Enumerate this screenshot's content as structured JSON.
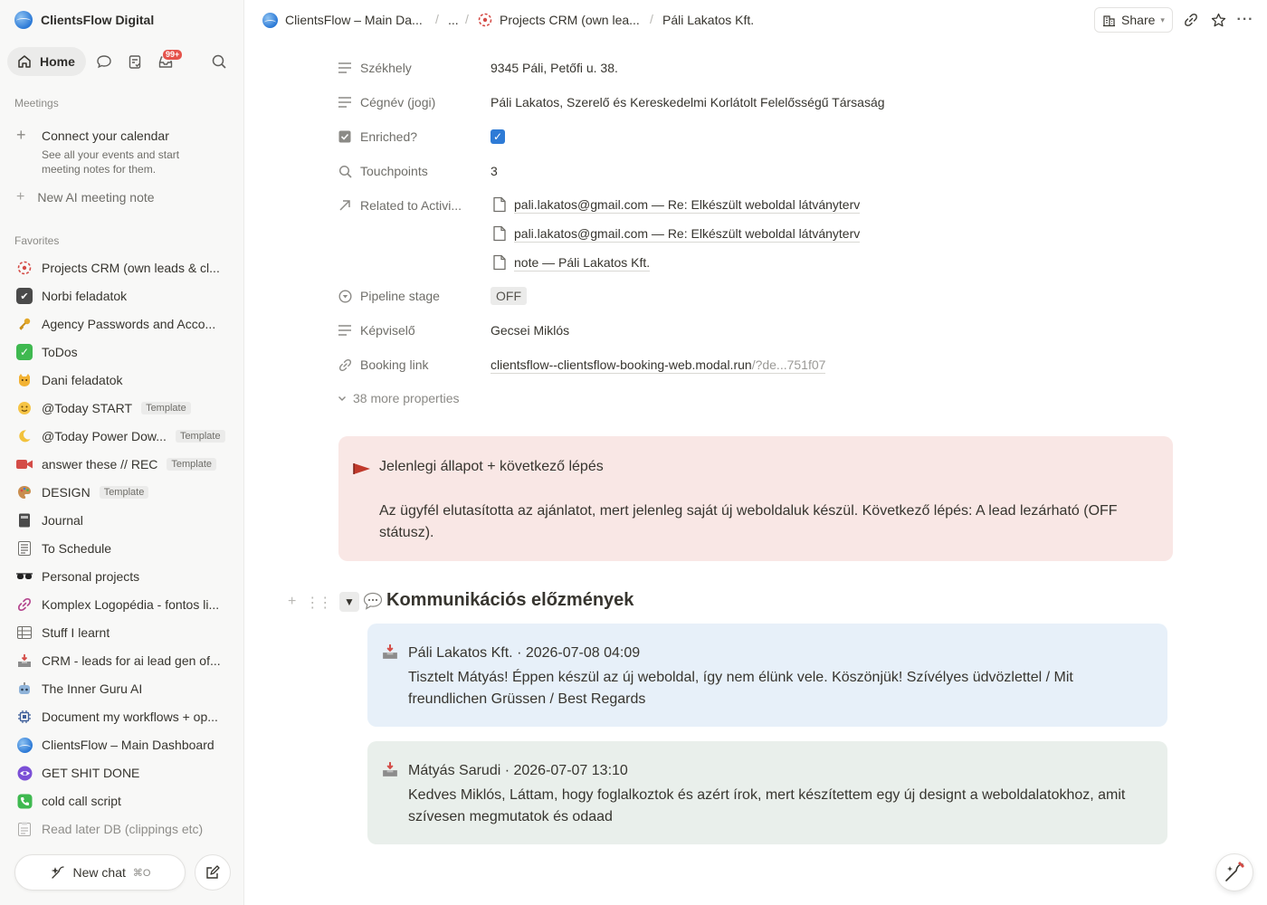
{
  "sidebar": {
    "workspace": "ClientsFlow Digital",
    "home_label": "Home",
    "inbox_badge": "99+",
    "meetings_title": "Meetings",
    "calendar_title": "Connect your calendar",
    "calendar_desc": "See all your events and start meeting notes for them.",
    "ai_note": "New AI meeting note",
    "favorites_title": "Favorites",
    "favorites": [
      {
        "label": "Projects CRM (own leads & cl...",
        "icon": "crm-icon"
      },
      {
        "label": "Norbi feladatok",
        "icon": "checkbox-icon"
      },
      {
        "label": "Agency Passwords and Acco...",
        "icon": "key-icon"
      },
      {
        "label": "ToDos",
        "icon": "check-icon"
      },
      {
        "label": "Dani feladatok",
        "icon": "cat-icon"
      },
      {
        "label": "@Today START",
        "icon": "smile-icon",
        "tag": "Template"
      },
      {
        "label": "@Today Power Dow...",
        "icon": "moon-icon",
        "tag": "Template"
      },
      {
        "label": "answer these // REC",
        "icon": "video-icon",
        "tag": "Template"
      },
      {
        "label": "DESIGN",
        "icon": "palette-icon",
        "tag": "Template"
      },
      {
        "label": "Journal",
        "icon": "notebook-icon"
      },
      {
        "label": "To Schedule",
        "icon": "list-icon"
      },
      {
        "label": "Personal projects",
        "icon": "sunglasses-icon"
      },
      {
        "label": "Komplex Logopédia - fontos li...",
        "icon": "link-icon"
      },
      {
        "label": "Stuff I learnt",
        "icon": "table-icon"
      },
      {
        "label": "CRM - leads for ai lead gen of...",
        "icon": "inbox-tray-icon"
      },
      {
        "label": "The Inner Guru AI",
        "icon": "robot-icon"
      },
      {
        "label": "Document my workflows + op...",
        "icon": "chip-icon"
      },
      {
        "label": "ClientsFlow – Main Dashboard",
        "icon": "globe-icon"
      },
      {
        "label": "GET SHIT DONE",
        "icon": "eye-icon"
      },
      {
        "label": "cold call script",
        "icon": "phone-icon"
      },
      {
        "label": "Read later DB (clippings etc)",
        "icon": "clipboard-icon"
      }
    ],
    "new_chat": "New chat",
    "new_chat_shortcut": "⌘O"
  },
  "topbar": {
    "crumb1": "ClientsFlow – Main Da...",
    "crumb_ellipsis": "...",
    "crumb2": "Projects CRM (own lea...",
    "crumb3": "Páli Lakatos Kft.",
    "share": "Share"
  },
  "properties": {
    "szekhely_label": "Székhely",
    "szekhely_value": "9345 Páli, Petőfi u. 38.",
    "cegnev_label": "Cégnév (jogi)",
    "cegnev_value": "Páli Lakatos, Szerelő és Kereskedelmi Korlátolt Felelősségű Társaság",
    "enriched_label": "Enriched?",
    "touchpoints_label": "Touchpoints",
    "touchpoints_value": "3",
    "related_label": "Related to Activi...",
    "related": [
      "pali.lakatos@gmail.com — Re: Elkészült weboldal látványterv",
      "pali.lakatos@gmail.com — Re: Elkészült weboldal látványterv",
      "note — Páli Lakatos Kft."
    ],
    "pipeline_label": "Pipeline stage",
    "pipeline_value": "OFF",
    "kepviselo_label": "Képviselő",
    "kepviselo_value": "Gecsei Miklós",
    "booking_label": "Booking link",
    "booking_value": "clientsflow--clientsflow-booking-web.modal.run",
    "booking_suffix": "/?de...751f07",
    "more": "38 more properties"
  },
  "callout": {
    "title": "Jelenlegi állapot + következő lépés",
    "body": "Az ügyfél elutasította az ajánlatot, mert jelenleg saját új weboldaluk készül. Következő lépés: A lead lezárható (OFF státusz)."
  },
  "section": {
    "heading": "Kommunikációs előzmények"
  },
  "messages": [
    {
      "header": "Páli Lakatos Kft. · 2026-07-08 04:09",
      "body": "Tisztelt Mátyás! Éppen készül az új weboldal, így nem élünk vele. Köszönjük! Szívélyes üdvözlettel / Mit freundlichen Grüssen / Best Regards",
      "bg": "#e7f0f9"
    },
    {
      "header": "Mátyás Sarudi · 2026-07-07 13:10",
      "body": "Kedves Miklós, Láttam, hogy foglalkoztok és azért írok, mert készítettem egy új designt a weboldalatokhoz, amit szívesen megmutatok és odaad",
      "bg": "#e9efeb"
    }
  ]
}
